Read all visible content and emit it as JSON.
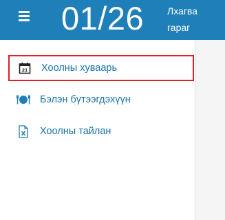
{
  "header": {
    "date": "01/26",
    "weekday": "Лхагва гараг"
  },
  "nav": {
    "items": [
      {
        "label": "Хоолны хуваарь",
        "icon": "calendar-icon",
        "active": true
      },
      {
        "label": "Бэлэн бүтээгдэхүүн",
        "icon": "plate-cutlery-icon",
        "active": false
      },
      {
        "label": "Хоолны тайлан",
        "icon": "excel-file-icon",
        "active": false
      }
    ]
  },
  "colors": {
    "header_bg": "#1f7fb9",
    "accent_text": "#1a73a8",
    "active_border": "#e01e26",
    "calendar_icon_day": "21"
  }
}
